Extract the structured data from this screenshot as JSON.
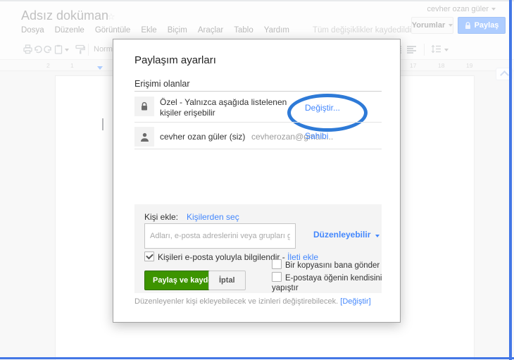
{
  "chrome": {
    "user_name": "cevher ozan güler",
    "doc_title": "Adsız doküman",
    "menu": [
      "Dosya",
      "Düzenle",
      "Görüntüle",
      "Ekle",
      "Biçim",
      "Araçlar",
      "Tablo",
      "Yardım"
    ],
    "save_status": "Tüm değişiklikler kaydedildi",
    "comments_label": "Yorumlar",
    "share_label": "Paylaş",
    "style_label": "Normal",
    "ruler_numbers_left": [
      "2",
      "1"
    ],
    "ruler_numbers_right": [
      "17",
      "18",
      "19"
    ]
  },
  "dialog": {
    "title": "Paylaşım ayarları",
    "access_header": "Erişimi olanlar",
    "visibility_row": {
      "text": "Özel - Yalnızca aşağıda listelenen kişiler erişebilir",
      "change_link": "Değiştir..."
    },
    "owner_row": {
      "name": "cevher ozan güler (siz)",
      "email": "cevherozan@gmail....",
      "role": "Sahibi"
    },
    "add_people": {
      "label": "Kişi ekle:",
      "choose_link": "Kişilerden seç",
      "input_placeholder": "Adları, e-posta adreslerini veya grupları girin...",
      "permission_dropdown": "Düzenleyebilir",
      "notify_label": "Kişileri e-posta yoluyla bilgilendir - ",
      "add_message_link": "İleti ekle",
      "send_copy_label": "Bir kopyasını bana gönder",
      "paste_item_label_line1": "E-postaya öğenin kendisini",
      "paste_item_label_line2": "yapıştır",
      "share_save_button": "Paylaş ve kaydet",
      "cancel_button": "İptal"
    },
    "footer_text": "Düzenleyenler kişi ekleyebilecek ve izinleri değiştirebilecek.",
    "footer_link": "[Değiştir]"
  },
  "colors": {
    "link_blue": "#4387fd",
    "share_button_blue": "#4d90fe",
    "green_button": "#3d9400",
    "annotation_ellipse_blue": "#2e7ad7",
    "window_frame_blue": "#4377e6"
  }
}
